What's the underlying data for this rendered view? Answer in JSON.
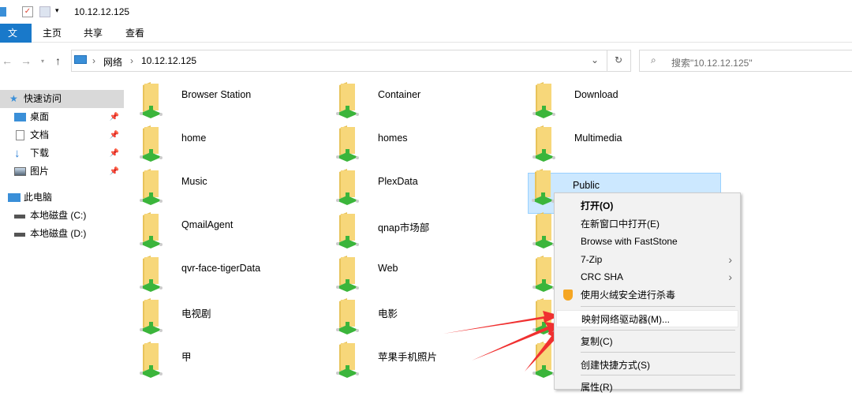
{
  "window": {
    "title": "10.12.12.125"
  },
  "ribbon": {
    "tabs": [
      "文件",
      "主页",
      "共享",
      "查看"
    ]
  },
  "address": {
    "crumbs": [
      "网络",
      "10.12.12.125"
    ],
    "search_placeholder": "搜索\"10.12.12.125\""
  },
  "sidebar": {
    "quick_access": "快速访问",
    "items": [
      "桌面",
      "文档",
      "下载",
      "图片"
    ],
    "this_pc": "此电脑",
    "drives": [
      "本地磁盘 (C:)",
      "本地磁盘 (D:)"
    ]
  },
  "folders": [
    "Browser Station",
    "Container",
    "Download",
    "home",
    "homes",
    "Multimedia",
    "Music",
    "PlexData",
    "Public",
    "QmailAgent",
    "qnap市场部",
    "",
    "qvr-face-tigerData",
    "Web",
    "",
    "电视剧",
    "电影",
    "",
    "甲",
    "苹果手机照片",
    ""
  ],
  "context_menu": {
    "items": [
      "打开(O)",
      "在新窗口中打开(E)",
      "Browse with FastStone",
      "7-Zip",
      "CRC SHA",
      "使用火绒安全进行杀毒",
      "映射网络驱动器(M)...",
      "复制(C)",
      "创建快捷方式(S)",
      "属性(R)"
    ]
  },
  "colors": {
    "accent": "#1979ca",
    "selection": "#cce8ff",
    "arrow": "#f03030"
  }
}
